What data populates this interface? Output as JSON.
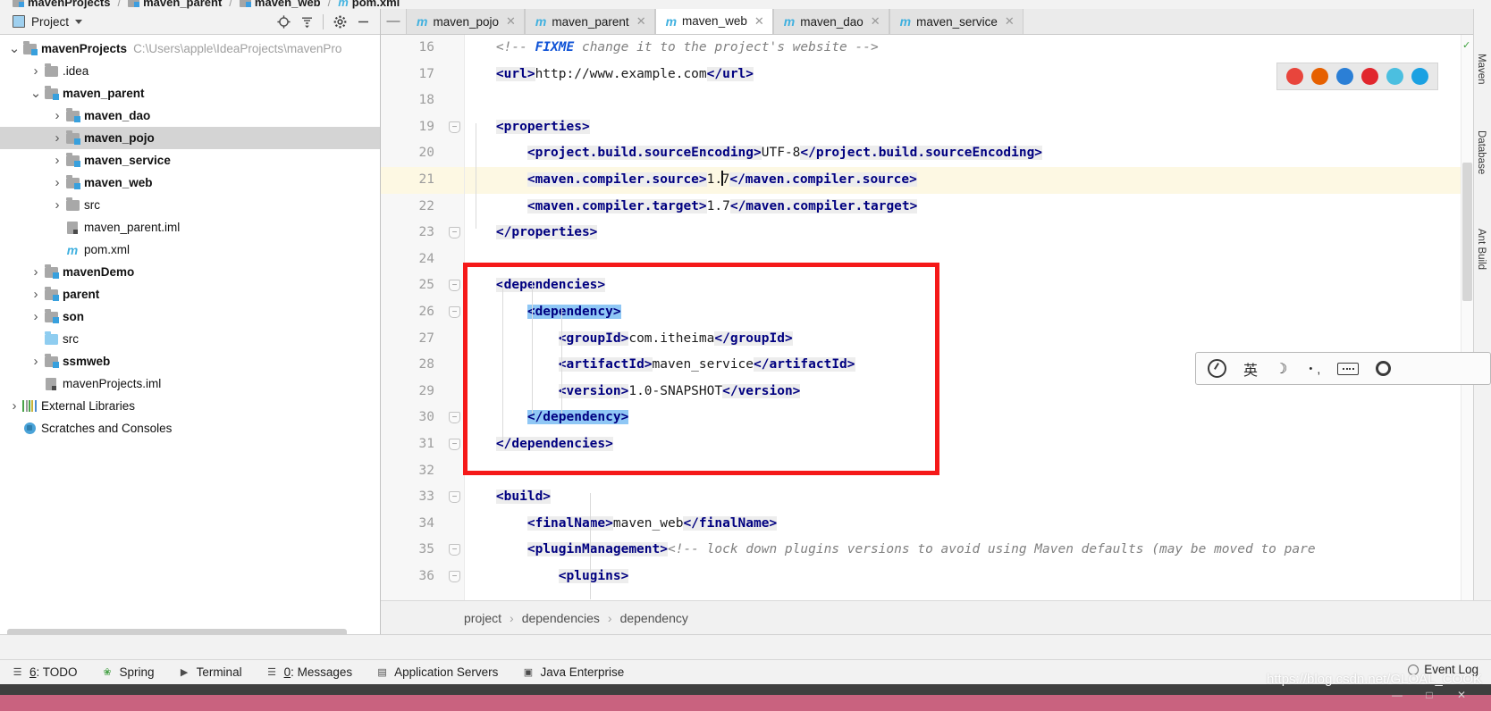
{
  "top_breadcrumb": [
    {
      "label": "mavenProjects",
      "icon": "module-folder-icon"
    },
    {
      "label": "maven_parent",
      "icon": "module-folder-icon"
    },
    {
      "label": "maven_web",
      "icon": "module-folder-icon"
    },
    {
      "label": "pom.xml",
      "icon": "maven-m-icon"
    }
  ],
  "project_panel": {
    "title": "Project",
    "toolbar": [
      {
        "name": "locate-icon",
        "glyph": "⊕"
      },
      {
        "name": "collapse-all-icon",
        "glyph": "≡"
      },
      {
        "name": "settings-gear-icon",
        "glyph": "⚙"
      },
      {
        "name": "hide-icon",
        "glyph": "—"
      }
    ],
    "tree": [
      {
        "label": "mavenProjects",
        "path": "C:\\Users\\apple\\IdeaProjects\\mavenPro",
        "indent": 0,
        "twist": "⌄",
        "icon": "module-folder-icon",
        "bold": true,
        "selected": false
      },
      {
        "label": ".idea",
        "path": "",
        "indent": 1,
        "twist": "›",
        "icon": "folder-icon",
        "bold": false,
        "selected": false
      },
      {
        "label": "maven_parent",
        "path": "",
        "indent": 1,
        "twist": "⌄",
        "icon": "module-folder-icon",
        "bold": true,
        "selected": false
      },
      {
        "label": "maven_dao",
        "path": "",
        "indent": 2,
        "twist": "›",
        "icon": "module-folder-icon",
        "bold": true,
        "selected": false
      },
      {
        "label": "maven_pojo",
        "path": "",
        "indent": 2,
        "twist": "›",
        "icon": "module-folder-icon",
        "bold": true,
        "selected": true
      },
      {
        "label": "maven_service",
        "path": "",
        "indent": 2,
        "twist": "›",
        "icon": "module-folder-icon",
        "bold": true,
        "selected": false
      },
      {
        "label": "maven_web",
        "path": "",
        "indent": 2,
        "twist": "›",
        "icon": "module-folder-icon",
        "bold": true,
        "selected": false
      },
      {
        "label": "src",
        "path": "",
        "indent": 2,
        "twist": "›",
        "icon": "folder-icon",
        "bold": false,
        "selected": false
      },
      {
        "label": "maven_parent.iml",
        "path": "",
        "indent": 2,
        "twist": "",
        "icon": "iml-file-icon",
        "bold": false,
        "selected": false
      },
      {
        "label": "pom.xml",
        "path": "",
        "indent": 2,
        "twist": "",
        "icon": "maven-m-icon",
        "bold": false,
        "selected": false
      },
      {
        "label": "mavenDemo",
        "path": "",
        "indent": 1,
        "twist": "›",
        "icon": "module-folder-icon",
        "bold": true,
        "selected": false
      },
      {
        "label": "parent",
        "path": "",
        "indent": 1,
        "twist": "›",
        "icon": "module-folder-icon",
        "bold": true,
        "selected": false
      },
      {
        "label": "son",
        "path": "",
        "indent": 1,
        "twist": "›",
        "icon": "module-folder-icon",
        "bold": true,
        "selected": false
      },
      {
        "label": "src",
        "path": "",
        "indent": 1,
        "twist": "",
        "icon": "source-folder-icon",
        "bold": false,
        "selected": false
      },
      {
        "label": "ssmweb",
        "path": "",
        "indent": 1,
        "twist": "›",
        "icon": "module-folder-icon",
        "bold": true,
        "selected": false
      },
      {
        "label": "mavenProjects.iml",
        "path": "",
        "indent": 1,
        "twist": "",
        "icon": "iml-file-icon",
        "bold": false,
        "selected": false
      },
      {
        "label": "External Libraries",
        "path": "",
        "indent": 0,
        "twist": "›",
        "icon": "libraries-icon",
        "bold": false,
        "selected": false
      },
      {
        "label": "Scratches and Consoles",
        "path": "",
        "indent": 0,
        "twist": "",
        "icon": "scratches-icon",
        "bold": false,
        "selected": false
      }
    ]
  },
  "tabs": [
    {
      "label": "maven_pojo",
      "active": false
    },
    {
      "label": "maven_parent",
      "active": false
    },
    {
      "label": "maven_web",
      "active": true
    },
    {
      "label": "maven_dao",
      "active": false
    },
    {
      "label": "maven_service",
      "active": false
    }
  ],
  "editor": {
    "first_line": 16,
    "current_line": 21,
    "lines": [
      {
        "n": 16,
        "fold": "",
        "indent": 0,
        "segs": [
          {
            "t": "<!-- ",
            "c": "cmt"
          },
          {
            "t": "FIXME",
            "c": "cmt-b"
          },
          {
            "t": " change it to the project's website -->",
            "c": "cmt"
          }
        ]
      },
      {
        "n": 17,
        "fold": "",
        "indent": 0,
        "segs": [
          {
            "t": "<url>",
            "c": "tag hl"
          },
          {
            "t": "http://www.example.com",
            "c": "txt"
          },
          {
            "t": "</url>",
            "c": "tag hl"
          }
        ]
      },
      {
        "n": 18,
        "fold": "",
        "indent": 0,
        "segs": []
      },
      {
        "n": 19,
        "fold": "−",
        "indent": 0,
        "segs": [
          {
            "t": "<properties>",
            "c": "tag hl"
          }
        ]
      },
      {
        "n": 20,
        "fold": "",
        "indent": 1,
        "segs": [
          {
            "t": "<project.build.sourceEncoding>",
            "c": "tag hl"
          },
          {
            "t": "UTF-8",
            "c": "txt"
          },
          {
            "t": "</project.build.sourceEncoding>",
            "c": "tag hl"
          }
        ]
      },
      {
        "n": 21,
        "fold": "",
        "indent": 1,
        "segs": [
          {
            "t": "<maven.compiler.source>",
            "c": "tag hl"
          },
          {
            "t": "1.",
            "c": "txt"
          },
          {
            "t": "|",
            "c": "caret"
          },
          {
            "t": "7",
            "c": "txt"
          },
          {
            "t": "</maven.compiler.source>",
            "c": "tag hl"
          }
        ]
      },
      {
        "n": 22,
        "fold": "",
        "indent": 1,
        "segs": [
          {
            "t": "<maven.compiler.target>",
            "c": "tag hl"
          },
          {
            "t": "1.7",
            "c": "txt"
          },
          {
            "t": "</maven.compiler.target>",
            "c": "tag hl"
          }
        ]
      },
      {
        "n": 23,
        "fold": "−",
        "indent": 0,
        "segs": [
          {
            "t": "</properties>",
            "c": "tag hl"
          }
        ]
      },
      {
        "n": 24,
        "fold": "",
        "indent": 0,
        "segs": []
      },
      {
        "n": 25,
        "fold": "−",
        "indent": 0,
        "segs": [
          {
            "t": "<dependencies>",
            "c": "tag hl"
          }
        ]
      },
      {
        "n": 26,
        "fold": "−",
        "indent": 1,
        "segs": [
          {
            "t": "<dependency>",
            "c": "tag selblue"
          }
        ]
      },
      {
        "n": 27,
        "fold": "",
        "indent": 2,
        "segs": [
          {
            "t": "<groupId>",
            "c": "tag hl"
          },
          {
            "t": "com.itheima",
            "c": "txt"
          },
          {
            "t": "</groupId>",
            "c": "tag hl"
          }
        ]
      },
      {
        "n": 28,
        "fold": "",
        "indent": 2,
        "segs": [
          {
            "t": "<artifactId>",
            "c": "tag hl"
          },
          {
            "t": "maven_service",
            "c": "txt"
          },
          {
            "t": "</artifactId>",
            "c": "tag hl"
          }
        ]
      },
      {
        "n": 29,
        "fold": "",
        "indent": 2,
        "segs": [
          {
            "t": "<version>",
            "c": "tag hl"
          },
          {
            "t": "1.0-SNAPSHOT",
            "c": "txt"
          },
          {
            "t": "</version>",
            "c": "tag hl"
          }
        ]
      },
      {
        "n": 30,
        "fold": "−",
        "indent": 1,
        "segs": [
          {
            "t": "</dependency>",
            "c": "tag selblue"
          }
        ]
      },
      {
        "n": 31,
        "fold": "−",
        "indent": 0,
        "segs": [
          {
            "t": "</dependencies>",
            "c": "tag hl"
          }
        ]
      },
      {
        "n": 32,
        "fold": "",
        "indent": 0,
        "segs": []
      },
      {
        "n": 33,
        "fold": "−",
        "indent": 0,
        "segs": [
          {
            "t": "<build>",
            "c": "tag hl"
          }
        ]
      },
      {
        "n": 34,
        "fold": "",
        "indent": 1,
        "segs": [
          {
            "t": "<finalName>",
            "c": "tag hl"
          },
          {
            "t": "maven_web",
            "c": "txt"
          },
          {
            "t": "</finalName>",
            "c": "tag hl"
          }
        ]
      },
      {
        "n": 35,
        "fold": "−",
        "indent": 1,
        "segs": [
          {
            "t": "<pluginManagement>",
            "c": "tag hl"
          },
          {
            "t": "<!-- lock down plugins versions to avoid using Maven defaults (may be moved to pare",
            "c": "cmt"
          }
        ]
      },
      {
        "n": 36,
        "fold": "−",
        "indent": 2,
        "segs": [
          {
            "t": "<plugins>",
            "c": "tag hl"
          }
        ]
      }
    ],
    "breadcrumb": [
      "project",
      "dependencies",
      "dependency"
    ],
    "browser_icons": [
      {
        "name": "chrome-icon",
        "color": "#e8453c"
      },
      {
        "name": "firefox-icon",
        "color": "#e66000"
      },
      {
        "name": "safari-icon",
        "color": "#2b7fd6"
      },
      {
        "name": "opera-icon",
        "color": "#e1272e"
      },
      {
        "name": "edge-legacy-icon",
        "color": "#4bbfe0"
      },
      {
        "name": "edge-icon",
        "color": "#1ba1e2"
      }
    ]
  },
  "right_rail_tabs": [
    "Maven",
    "Database",
    "Ant Build"
  ],
  "bottom_toolwindows": [
    {
      "label": "6: TODO",
      "icon": "todo-icon",
      "glyph": "☰",
      "mnemonic": "6"
    },
    {
      "label": "Spring",
      "icon": "spring-leaf-icon",
      "glyph": "❀",
      "mnemonic": ""
    },
    {
      "label": "Terminal",
      "icon": "terminal-icon",
      "glyph": "▶",
      "mnemonic": ""
    },
    {
      "label": "0: Messages",
      "icon": "messages-icon",
      "glyph": "☰",
      "mnemonic": "0"
    },
    {
      "label": "Application Servers",
      "icon": "app-servers-icon",
      "glyph": "▤",
      "mnemonic": ""
    },
    {
      "label": "Java Enterprise",
      "icon": "java-enterprise-icon",
      "glyph": "▣",
      "mnemonic": ""
    }
  ],
  "event_log": {
    "label": "Event Log",
    "icon": "event-log-icon"
  },
  "watermark": "https://blog.csdn.net/GLOAL_COOK",
  "ime_bar": {
    "items": [
      {
        "name": "ime-logo-icon",
        "glyph": ""
      },
      {
        "name": "ime-language-label",
        "glyph": "英"
      },
      {
        "name": "ime-moon-icon",
        "glyph": "☽"
      },
      {
        "name": "ime-punct-icon",
        "glyph": "・,"
      },
      {
        "name": "ime-keyboard-icon",
        "glyph": ""
      },
      {
        "name": "ime-settings-icon",
        "glyph": ""
      }
    ]
  },
  "colors": {
    "tag": "#000080",
    "comment": "#808080",
    "fixme": "#0f53d6",
    "selection": "#8fc7f5",
    "annotation_box": "#f51919",
    "current_line": "#fdf8e3",
    "tree_selected": "#d4d4d4"
  }
}
